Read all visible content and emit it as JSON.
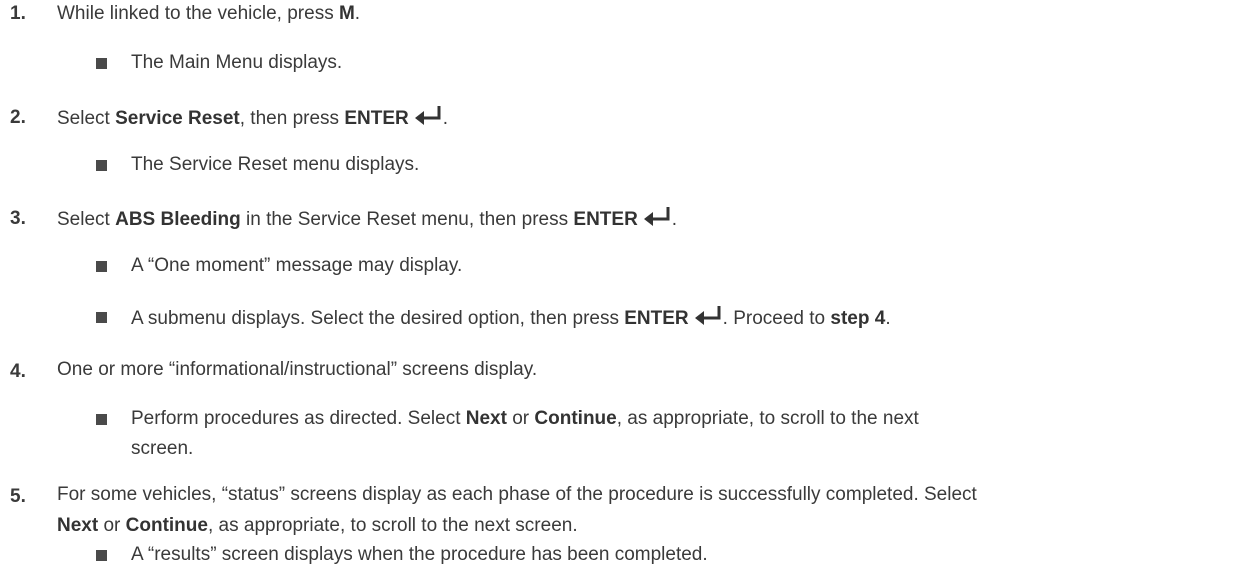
{
  "steps": [
    {
      "number": "1.",
      "parts": [
        "While linked to the vehicle, press ",
        "M",
        "."
      ],
      "bullets": [
        {
          "text": "The Main Menu displays."
        }
      ]
    },
    {
      "number": "2.",
      "parts": [
        "Select ",
        "Service Reset",
        ", then press ",
        "ENTER",
        "."
      ],
      "bullets": [
        {
          "text": "The Service Reset menu displays."
        }
      ]
    },
    {
      "number": "3.",
      "parts": [
        "Select ",
        "ABS Bleeding",
        " in the Service Reset menu, then press ",
        "ENTER",
        "."
      ],
      "bullets": [
        {
          "text": "A “One moment” message may display."
        },
        {
          "parts": [
            "A submenu displays. Select the desired option, then press ",
            "ENTER",
            ". Proceed to ",
            "step 4",
            "."
          ]
        }
      ]
    },
    {
      "number": "4.",
      "parts": [
        "One or more “informational/instructional” screens display."
      ],
      "bullets": [
        {
          "parts": [
            "Perform procedures as directed. Select ",
            "Next",
            " or ",
            "Continue",
            ", as appropriate, to scroll to the next"
          ],
          "cont": "screen."
        }
      ]
    },
    {
      "number": "5.",
      "parts": [
        "For some vehicles, “status” screens display as each phase of the procedure is successfully completed. Select"
      ],
      "cont_parts": [
        "Next",
        " or ",
        "Continue",
        ", as appropriate, to scroll to the next screen."
      ],
      "bullets": [
        {
          "text": "A “results” screen displays when the procedure has been completed."
        }
      ]
    }
  ],
  "icons": {
    "enter": "enter-return-arrow-icon"
  }
}
